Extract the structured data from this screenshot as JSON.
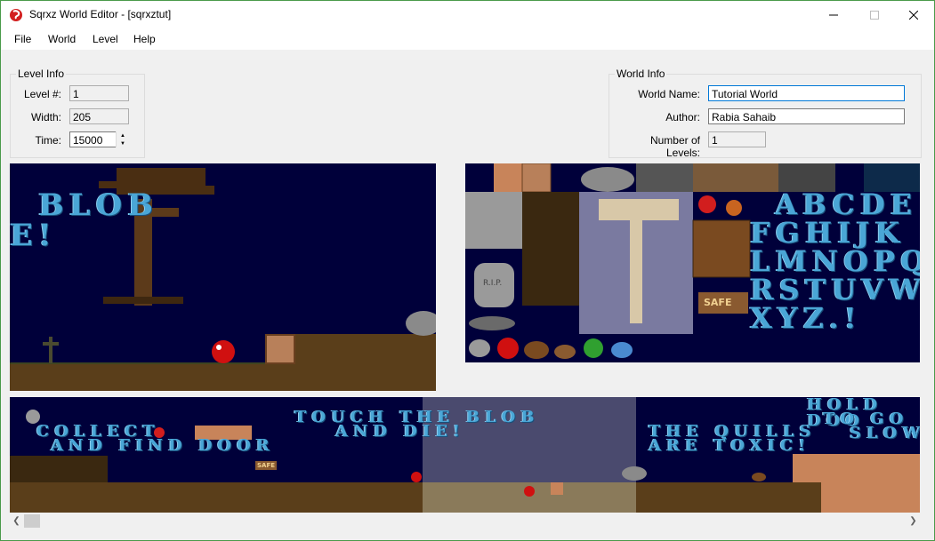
{
  "window": {
    "title": "Sqrxz World Editor - [sqrxztut]",
    "controls": {
      "minimize": "─",
      "maximize": "☐",
      "close": "✕"
    }
  },
  "menu": [
    "File",
    "World",
    "Level",
    "Help"
  ],
  "level_info": {
    "legend": "Level Info",
    "level_label": "Level #:",
    "level_value": "1",
    "width_label": "Width:",
    "width_value": "205",
    "time_label": "Time:",
    "time_value": "15000"
  },
  "world_info": {
    "legend": "World Info",
    "name_label": "World Name:",
    "name_value": "Tutorial World",
    "author_label": "Author:",
    "author_value": "Rabia Sahaib",
    "levels_label": "Number of Levels:",
    "levels_value": "1"
  },
  "preview": {
    "sign_fragment_1": "BLOB",
    "sign_fragment_2": "E!"
  },
  "tileset": {
    "alphabet_rows": [
      "ABCDE",
      "FGHIJK",
      "LMNOPQ",
      "RSTUVW",
      "XYZ.!"
    ],
    "safe_sign": "SAFE",
    "rip": "R.I.P."
  },
  "level_strip": {
    "text_collect": "COLLECT",
    "text_find_door": "AND FIND DOOR",
    "text_touch": "TOUCH THE BLOB",
    "text_and_die": "AND DIE!",
    "text_quills": "THE QUILLS",
    "text_toxic": "ARE TOXIC!",
    "text_hold": "HOLD DOO",
    "text_to_go": "TO GO",
    "text_slow": "SLOW.",
    "safe_sign": "SAFE"
  },
  "scrollbar": {
    "left_arrow": "❮",
    "right_arrow": "❯"
  },
  "colors": {
    "sky": "#00003a",
    "dirt": "#5a3e1a",
    "text_blue": "#4aa6d6",
    "brick": "#c8845a"
  }
}
